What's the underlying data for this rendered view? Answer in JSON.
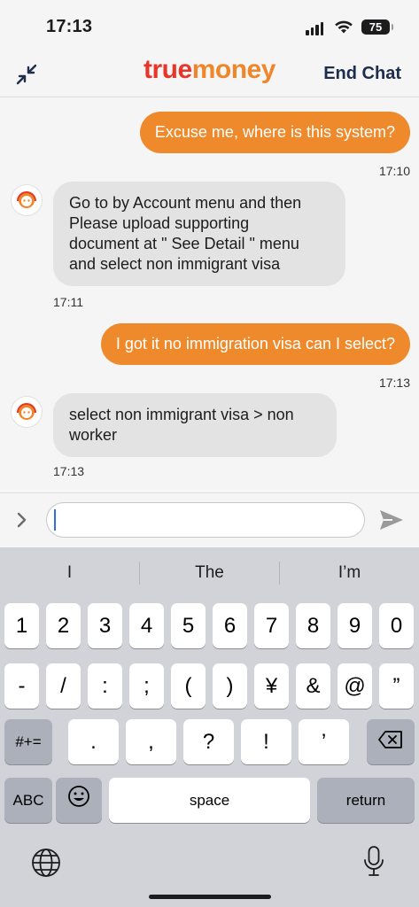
{
  "status_bar": {
    "time": "17:13",
    "battery": "75"
  },
  "header": {
    "logo_true": "true",
    "logo_money": "money",
    "end_chat_label": "End Chat"
  },
  "messages": [
    {
      "sender": "user",
      "text": "Excuse me, where is this system?",
      "time": "17:10"
    },
    {
      "sender": "agent",
      "lines": [
        "Go to by Account menu and then",
        "Please upload supporting",
        "document at \" See Detail \" menu",
        "and select non immigrant visa"
      ],
      "time": "17:11"
    },
    {
      "sender": "user",
      "text": "I got it no immigration visa can I select?",
      "time": "17:13"
    },
    {
      "sender": "agent",
      "lines": [
        "select non immigrant visa > non",
        "worker"
      ],
      "time": "17:13"
    }
  ],
  "composer": {
    "input_value": ""
  },
  "keyboard": {
    "suggestions": [
      "I",
      "The",
      "I’m"
    ],
    "row1": [
      "1",
      "2",
      "3",
      "4",
      "5",
      "6",
      "7",
      "8",
      "9",
      "0"
    ],
    "row2": [
      "-",
      "/",
      ":",
      ";",
      "(",
      ")",
      "¥",
      "&",
      "@",
      "”"
    ],
    "row3": [
      ".",
      ",",
      "?",
      "!",
      "’"
    ],
    "symbols_label": "#+=",
    "abc_label": "ABC",
    "space_label": "space",
    "return_label": "return"
  },
  "colors": {
    "brand_red": "#e8352b",
    "brand_orange": "#ef8a2c",
    "header_text": "#1f2d4d",
    "incoming_bubble": "#e3e3e3",
    "keyboard_bg": "#d1d3d9"
  },
  "icons": [
    "minimize-arrows-icon",
    "agent-avatar-icon",
    "chevron-right-icon",
    "send-icon",
    "delete-backspace-icon",
    "emoji-icon",
    "globe-icon",
    "microphone-icon",
    "wifi-icon",
    "signal-icon"
  ]
}
